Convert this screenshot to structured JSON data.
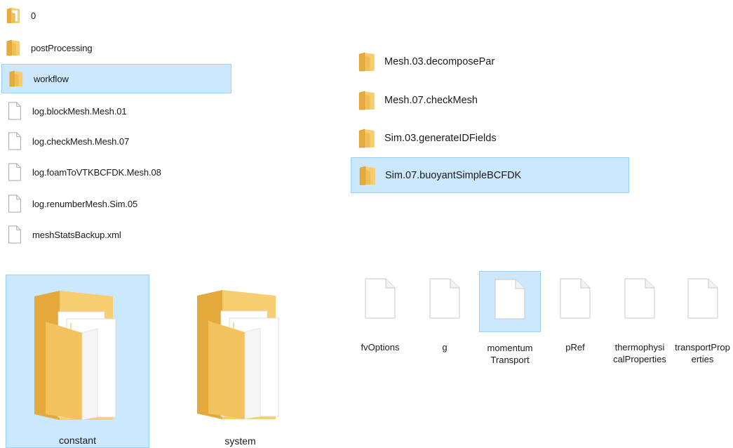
{
  "left_list": {
    "items": [
      {
        "label": "0",
        "icon": "folder-doc-icon",
        "selected": false
      },
      {
        "label": "postProcessing",
        "icon": "folder-icon",
        "selected": false
      },
      {
        "label": "workflow",
        "icon": "folder-icon",
        "selected": true
      },
      {
        "label": "log.blockMesh.Mesh.01",
        "icon": "file-icon",
        "selected": false
      },
      {
        "label": "log.checkMesh.Mesh.07",
        "icon": "file-icon",
        "selected": false
      },
      {
        "label": "log.foamToVTKBCFDK.Mesh.08",
        "icon": "file-icon",
        "selected": false
      },
      {
        "label": "log.renumberMesh.Sim.05",
        "icon": "file-icon",
        "selected": false
      },
      {
        "label": "meshStatsBackup.xml",
        "icon": "file-icon",
        "selected": false
      }
    ]
  },
  "right_list": {
    "items": [
      {
        "label": "Mesh.03.decomposePar",
        "icon": "folder-icon",
        "selected": false
      },
      {
        "label": "Mesh.07.checkMesh",
        "icon": "folder-icon",
        "selected": false
      },
      {
        "label": "Sim.03.generateIDFields",
        "icon": "folder-icon",
        "selected": false
      },
      {
        "label": "Sim.07.buoyantSimpleBCFDK",
        "icon": "folder-icon",
        "selected": true
      }
    ]
  },
  "large_folders": {
    "items": [
      {
        "label": "constant",
        "icon": "folder-with-documents-icon",
        "selected": true
      },
      {
        "label": "system",
        "icon": "folder-with-documents-icon",
        "selected": false
      }
    ]
  },
  "file_tiles": {
    "items": [
      {
        "label": "fvOptions",
        "icon": "file-icon",
        "selected": false
      },
      {
        "label": "g",
        "icon": "file-icon",
        "selected": false
      },
      {
        "label": "momentum Transport",
        "icon": "file-icon",
        "selected": true
      },
      {
        "label": "pRef",
        "icon": "file-icon",
        "selected": false
      },
      {
        "label": "thermophysicalProperties",
        "icon": "file-icon",
        "selected": false
      },
      {
        "label": "transportProperties",
        "icon": "file-icon",
        "selected": false
      }
    ]
  },
  "colors": {
    "selection_bg": "#cce8ff",
    "selection_border": "#99d1ff",
    "folder_yellow": "#f5c86a"
  }
}
